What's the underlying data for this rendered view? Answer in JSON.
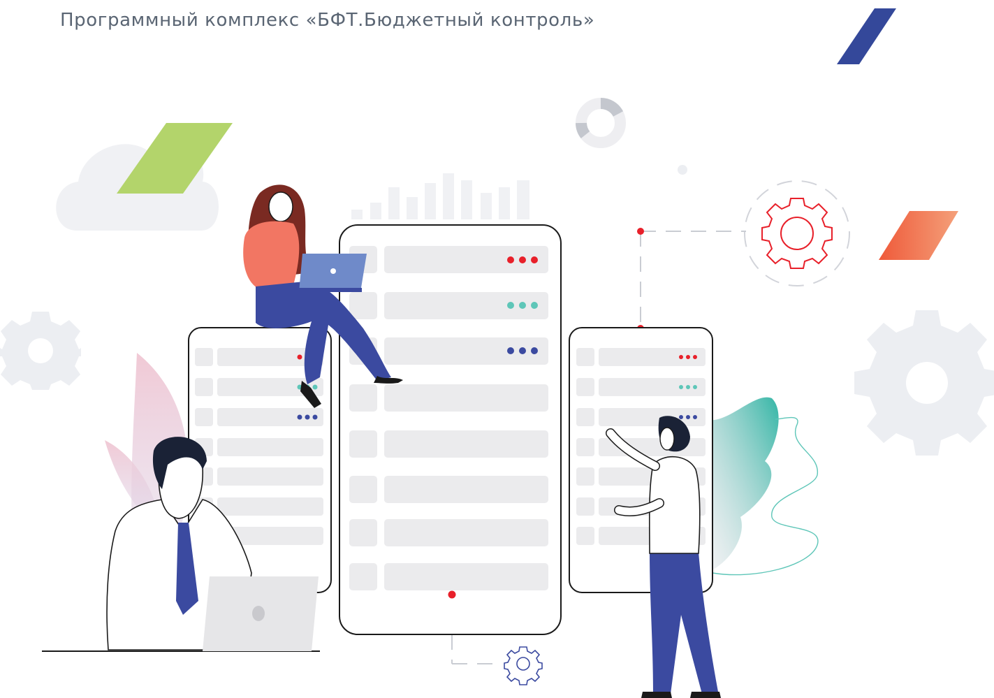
{
  "header": {
    "title": "Программный комплекс «БФТ.Бюджетный контроль»"
  },
  "colors": {
    "accent_blue": "#34489a",
    "accent_green": "#b3d46b",
    "accent_red": "#e8202a",
    "accent_teal": "#5ec6b8",
    "navy": "#3b4aa0",
    "text_gray": "#5a6573",
    "panel_gray": "#ebebed",
    "bg_gray": "#f0f1f4"
  },
  "illustration": {
    "icons": [
      "gear-icon",
      "cloud-icon",
      "donut-chart-icon",
      "bar-chart-icon",
      "laptop-icon",
      "server-icon"
    ],
    "server_indicator_dots": [
      "red",
      "teal",
      "navy"
    ]
  }
}
